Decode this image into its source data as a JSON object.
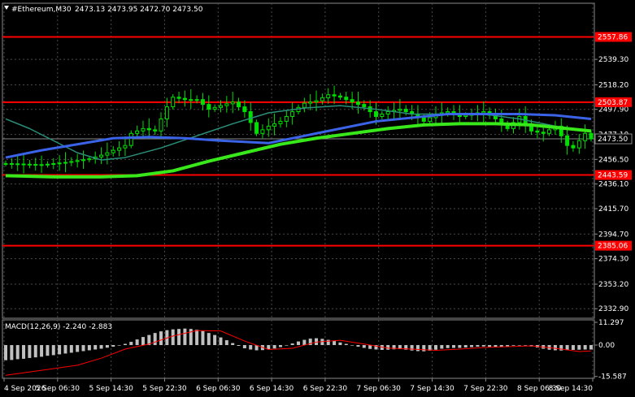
{
  "header": {
    "symbol_timeframe": "#Ethereum,M30",
    "ohlc": "2473.13 2473.95 2472.70 2473.50"
  },
  "macd_header": "MACD(12,26,9) -2.240 -2.883",
  "colors": {
    "background": "#000000",
    "grid": "#4a4a4a",
    "candle_up": "#00e000",
    "candle_down": "#00e000",
    "ma_fast": "#2a8f7a",
    "ma_mid": "#3a63e8",
    "ma_slow": "#39e81a",
    "level_line": "#ff0000",
    "macd_hist": "#c0c0c0",
    "macd_signal": "#ff0000"
  },
  "chart_data": [
    {
      "type": "candlestick",
      "title": "#Ethereum,M30",
      "ylim": [
        2325.0,
        2577.0
      ],
      "y_ticks": [
        "2539.30",
        "2518.20",
        "2497.90",
        "2477.10",
        "2456.50",
        "2436.10",
        "2415.70",
        "2394.70",
        "2374.30",
        "2353.20",
        "2332.90"
      ],
      "x_ticks": [
        "4 Sep 2026",
        "5 Sep 06:30",
        "5 Sep 14:30",
        "5 Sep 22:30",
        "6 Sep 06:30",
        "6 Sep 14:30",
        "6 Sep 22:30",
        "7 Sep 06:30",
        "7 Sep 14:30",
        "7 Sep 22:30",
        "8 Sep 06:30",
        "8 Sep 14:30"
      ],
      "current_price": "2473.50",
      "levels": [
        "2557.86",
        "2503.87",
        "2443.59",
        "2385.06"
      ],
      "price_path": [
        [
          0,
          2453
        ],
        [
          6,
          2452
        ],
        [
          10,
          2454
        ],
        [
          14,
          2457
        ],
        [
          16,
          2460
        ],
        [
          18,
          2464
        ],
        [
          20,
          2468
        ],
        [
          21,
          2478
        ],
        [
          23,
          2482
        ],
        [
          25,
          2480
        ],
        [
          27,
          2500
        ],
        [
          28,
          2508
        ],
        [
          30,
          2506
        ],
        [
          32,
          2506
        ],
        [
          34,
          2498
        ],
        [
          36,
          2501
        ],
        [
          38,
          2504
        ],
        [
          40,
          2496
        ],
        [
          42,
          2478
        ],
        [
          44,
          2484
        ],
        [
          46,
          2488
        ],
        [
          48,
          2496
        ],
        [
          50,
          2503
        ],
        [
          52,
          2505
        ],
        [
          54,
          2510
        ],
        [
          56,
          2508
        ],
        [
          58,
          2504
        ],
        [
          60,
          2500
        ],
        [
          62,
          2492
        ],
        [
          64,
          2496
        ],
        [
          66,
          2498
        ],
        [
          68,
          2494
        ],
        [
          70,
          2488
        ],
        [
          72,
          2494
        ],
        [
          74,
          2496
        ],
        [
          76,
          2492
        ],
        [
          78,
          2494
        ],
        [
          80,
          2496
        ],
        [
          82,
          2490
        ],
        [
          84,
          2482
        ],
        [
          86,
          2492
        ],
        [
          88,
          2480
        ],
        [
          90,
          2478
        ],
        [
          92,
          2484
        ],
        [
          94,
          2468
        ],
        [
          95,
          2466
        ],
        [
          97,
          2478
        ],
        [
          98,
          2473.5
        ]
      ],
      "ma_fast": [
        [
          0,
          2490
        ],
        [
          4,
          2482
        ],
        [
          8,
          2472
        ],
        [
          12,
          2462
        ],
        [
          16,
          2456
        ],
        [
          20,
          2458
        ],
        [
          26,
          2466
        ],
        [
          32,
          2476
        ],
        [
          38,
          2486
        ],
        [
          44,
          2495
        ],
        [
          50,
          2499
        ],
        [
          56,
          2501
        ],
        [
          62,
          2498
        ],
        [
          68,
          2494
        ],
        [
          74,
          2494
        ],
        [
          80,
          2494
        ],
        [
          86,
          2490
        ],
        [
          92,
          2484
        ],
        [
          98,
          2480
        ]
      ],
      "ma_mid": [
        [
          0,
          2458
        ],
        [
          6,
          2464
        ],
        [
          12,
          2469
        ],
        [
          18,
          2474
        ],
        [
          24,
          2475
        ],
        [
          30,
          2474
        ],
        [
          36,
          2472
        ],
        [
          44,
          2470
        ],
        [
          50,
          2476
        ],
        [
          56,
          2482
        ],
        [
          62,
          2488
        ],
        [
          68,
          2491
        ],
        [
          74,
          2494
        ],
        [
          80,
          2494
        ],
        [
          86,
          2494
        ],
        [
          92,
          2493
        ],
        [
          98,
          2490
        ]
      ],
      "ma_slow": [
        [
          0,
          2443
        ],
        [
          8,
          2442
        ],
        [
          16,
          2442
        ],
        [
          22,
          2443
        ],
        [
          28,
          2447
        ],
        [
          34,
          2455
        ],
        [
          40,
          2462
        ],
        [
          46,
          2469
        ],
        [
          52,
          2474
        ],
        [
          58,
          2478
        ],
        [
          64,
          2482
        ],
        [
          70,
          2485
        ],
        [
          76,
          2486
        ],
        [
          82,
          2486
        ],
        [
          88,
          2485
        ],
        [
          94,
          2482
        ],
        [
          98,
          2480
        ]
      ]
    },
    {
      "type": "macd",
      "title": "MACD(12,26,9) -2.240 -2.883",
      "ylim": [
        -16.5,
        12.5
      ],
      "y_ticks": [
        "11.297",
        "0.00",
        "-15.587"
      ],
      "histogram": [
        -7.5,
        -7.4,
        -7.0,
        -6.8,
        -6.4,
        -6.1,
        -5.8,
        -5.3,
        -5.0,
        -4.6,
        -4.2,
        -3.8,
        -3.4,
        -3.0,
        -2.6,
        -2.2,
        -1.8,
        -1.3,
        -0.8,
        -0.2,
        0.6,
        1.6,
        2.8,
        4.0,
        5.0,
        6.0,
        6.8,
        7.4,
        7.8,
        8.0,
        8.2,
        8.0,
        7.6,
        7.0,
        6.0,
        5.0,
        3.8,
        2.4,
        1.0,
        -0.4,
        -1.6,
        -2.2,
        -2.6,
        -2.5,
        -2.2,
        -1.7,
        -1.0,
        -0.2,
        0.8,
        1.8,
        2.6,
        3.2,
        3.4,
        3.1,
        2.6,
        2.0,
        1.3,
        0.6,
        -0.2,
        -0.8,
        -1.4,
        -1.9,
        -2.2,
        -2.4,
        -2.3,
        -2.1,
        -2.0,
        -2.3,
        -2.7,
        -3.0,
        -3.1,
        -2.8,
        -2.3,
        -1.8,
        -1.5,
        -1.4,
        -1.4,
        -1.2,
        -1.0,
        -0.8,
        -0.7,
        -0.9,
        -1.0,
        -0.8,
        -0.6,
        -0.3,
        0.0,
        -0.2,
        -0.7,
        -1.2,
        -1.8,
        -2.3,
        -2.6,
        -2.7,
        -2.5,
        -2.4,
        -2.3,
        -2.2,
        -2.2
      ],
      "signal": [
        [
          0,
          -15.0
        ],
        [
          6,
          -12.5
        ],
        [
          12,
          -10.0
        ],
        [
          16,
          -6.5
        ],
        [
          20,
          -2.0
        ],
        [
          24,
          0.5
        ],
        [
          28,
          4.5
        ],
        [
          32,
          7.2
        ],
        [
          36,
          7.0
        ],
        [
          40,
          2.0
        ],
        [
          44,
          -2.2
        ],
        [
          48,
          -1.6
        ],
        [
          52,
          1.5
        ],
        [
          56,
          2.4
        ],
        [
          60,
          0.5
        ],
        [
          64,
          -1.5
        ],
        [
          68,
          -2.0
        ],
        [
          72,
          -2.6
        ],
        [
          76,
          -2.0
        ],
        [
          80,
          -1.2
        ],
        [
          84,
          -0.8
        ],
        [
          88,
          -0.4
        ],
        [
          92,
          -1.6
        ],
        [
          96,
          -3.2
        ],
        [
          98,
          -2.9
        ]
      ]
    }
  ]
}
